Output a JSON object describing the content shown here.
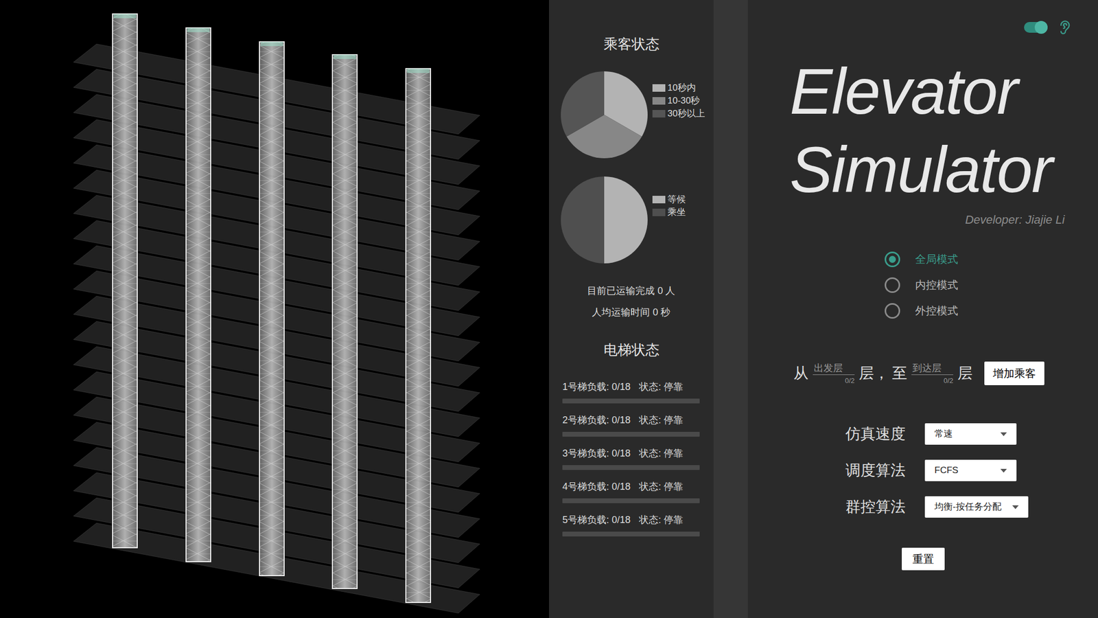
{
  "passenger_panel": {
    "title": "乘客状态",
    "wait_chart": {
      "legend": [
        {
          "label": "10秒内",
          "color": "#b3b3b3"
        },
        {
          "label": "10-30秒",
          "color": "#878787"
        },
        {
          "label": "30秒以上",
          "color": "#555555"
        }
      ],
      "values": [
        1,
        1,
        1
      ]
    },
    "ride_chart": {
      "legend": [
        {
          "label": "等候",
          "color": "#b3b3b3"
        },
        {
          "label": "乘坐",
          "color": "#4f4f4f"
        }
      ],
      "values": [
        1,
        1
      ]
    },
    "stats": [
      "目前已运输完成 0 人",
      "人均运输时间 0 秒"
    ]
  },
  "elevator_panel": {
    "title": "电梯状态",
    "elevators": [
      {
        "load_text": "1号梯负载: 0/18",
        "status_text": "状态: 停靠",
        "level": 0
      },
      {
        "load_text": "2号梯负载: 0/18",
        "status_text": "状态: 停靠",
        "level": 0
      },
      {
        "load_text": "3号梯负载: 0/18",
        "status_text": "状态: 停靠",
        "level": 0
      },
      {
        "load_text": "4号梯负载: 0/18",
        "status_text": "状态: 停靠",
        "level": 0
      },
      {
        "load_text": "5号梯负载: 0/18",
        "status_text": "状态: 停靠",
        "level": 0
      }
    ]
  },
  "sound_toggle": {
    "on": true
  },
  "title": [
    "Elevator",
    "Simulator"
  ],
  "developer": "Developer: Jiajie Li",
  "modes": [
    {
      "label": "全局模式",
      "selected": true
    },
    {
      "label": "内控模式",
      "selected": false
    },
    {
      "label": "外控模式",
      "selected": false
    }
  ],
  "add_passenger": {
    "from_text": "从",
    "from": {
      "placeholder": "出发层",
      "counter": "0/2"
    },
    "middle_text": "层，",
    "to_text": "至",
    "to": {
      "placeholder": "到达层",
      "counter": "0/2"
    },
    "end_text": "层",
    "button": "增加乘客"
  },
  "settings": [
    {
      "label": "仿真速度",
      "value": "常速"
    },
    {
      "label": "调度算法",
      "value": "FCFS"
    },
    {
      "label": "群控算法",
      "value": "均衡-按任务分配"
    }
  ],
  "reset_button": "重置"
}
